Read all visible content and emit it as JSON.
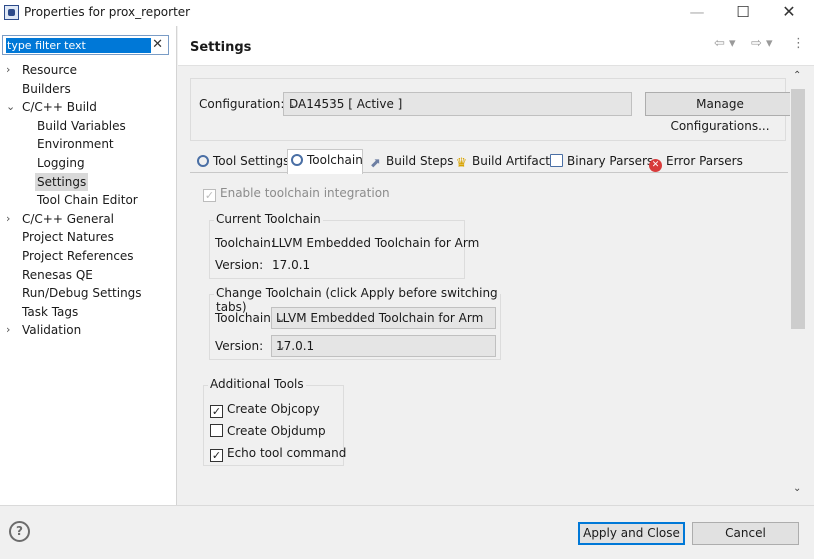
{
  "window": {
    "title": "Properties for prox_reporter",
    "minimize": "—",
    "maximize": "☐",
    "close": "✕"
  },
  "filter": {
    "placeholder": "type filter text",
    "clear": "✕"
  },
  "tree": [
    {
      "label": "Resource",
      "expander": "›"
    },
    {
      "label": "Builders",
      "expander": ""
    },
    {
      "label": "C/C++ Build",
      "expander": "⌄"
    },
    {
      "label": "Build Variables",
      "expander": ""
    },
    {
      "label": "Environment",
      "expander": ""
    },
    {
      "label": "Logging",
      "expander": ""
    },
    {
      "label": "Settings",
      "expander": ""
    },
    {
      "label": "Tool Chain Editor",
      "expander": ""
    },
    {
      "label": "C/C++ General",
      "expander": "›"
    },
    {
      "label": "Project Natures",
      "expander": ""
    },
    {
      "label": "Project References",
      "expander": ""
    },
    {
      "label": "Renesas QE",
      "expander": ""
    },
    {
      "label": "Run/Debug Settings",
      "expander": ""
    },
    {
      "label": "Task Tags",
      "expander": ""
    },
    {
      "label": "Validation",
      "expander": "›"
    }
  ],
  "header": {
    "title": "Settings",
    "back": "⇦ ▾",
    "forward": "⇨ ▾",
    "menu": "⋮"
  },
  "config": {
    "label": "Configuration:",
    "value": "DA14535  [ Active ]",
    "manage": "Manage Configurations..."
  },
  "tabs": [
    {
      "label": "Tool Settings",
      "icon": "gear-icon"
    },
    {
      "label": "Toolchain",
      "icon": "gear-icon"
    },
    {
      "label": "Build Steps",
      "icon": "build-steps-icon"
    },
    {
      "label": "Build Artifact",
      "icon": "trophy-icon"
    },
    {
      "label": "Binary Parsers",
      "icon": "binary-icon"
    },
    {
      "label": "Error Parsers",
      "icon": "error-icon"
    }
  ],
  "toolchain": {
    "enable_label": "Enable toolchain integration",
    "enable_checked": true,
    "current_group": "Current Toolchain",
    "current_toolchain_label": "Toolchain:",
    "current_toolchain": "LLVM Embedded Toolchain for Arm",
    "current_version_label": "Version:",
    "current_version": "17.0.1",
    "change_group": "Change Toolchain (click Apply before switching tabs)",
    "change_toolchain_label": "Toolchain:",
    "change_toolchain": "LLVM Embedded Toolchain for Arm",
    "change_version_label": "Version:",
    "change_version": "17.0.1"
  },
  "additional_tools": {
    "group": "Additional Tools",
    "items": [
      {
        "label": "Create Objcopy",
        "checked": true
      },
      {
        "label": "Create Objdump",
        "checked": false
      },
      {
        "label": "Echo tool command",
        "checked": true
      }
    ]
  },
  "footer": {
    "help": "?",
    "apply_close": "Apply and Close",
    "cancel": "Cancel"
  },
  "colors": {
    "accent": "#0078d7",
    "selection": "#d9d9d9"
  }
}
